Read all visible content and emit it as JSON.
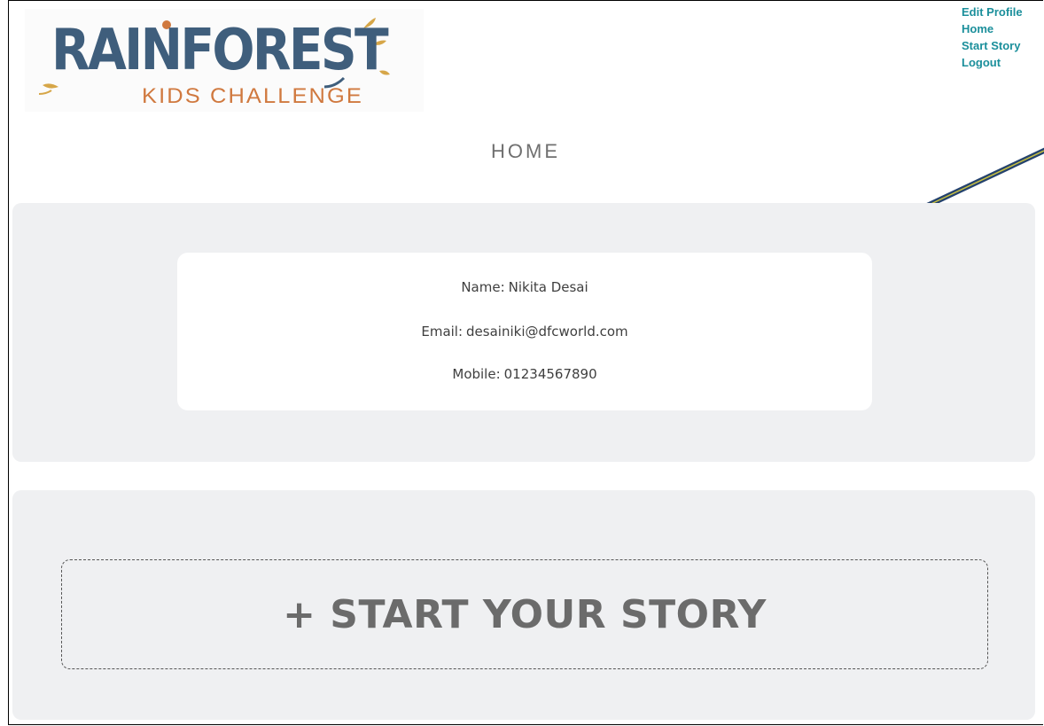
{
  "logo": {
    "title": "RAINFOREST",
    "subtitle": "KIDS CHALLENGE"
  },
  "nav": {
    "items": [
      {
        "label": "Edit Profile"
      },
      {
        "label": "Home"
      },
      {
        "label": "Start Story"
      },
      {
        "label": "Logout"
      }
    ]
  },
  "page": {
    "title": "HOME"
  },
  "profile": {
    "name_label": "Name:",
    "name_value": "Nikita Desai",
    "email_label": "Email:",
    "email_value": "desainiki@dfcworld.com",
    "mobile_label": "Mobile:",
    "mobile_value": "01234567890"
  },
  "story": {
    "button_label": "+ START YOUR STORY"
  },
  "colors": {
    "nav_link": "#1b8f9b",
    "logo_blue": "#3f5e7c",
    "logo_orange": "#d0793f",
    "logo_leaf": "#d6a648",
    "panel_bg": "#eff0f2",
    "annotation_line": "#c8c040"
  }
}
